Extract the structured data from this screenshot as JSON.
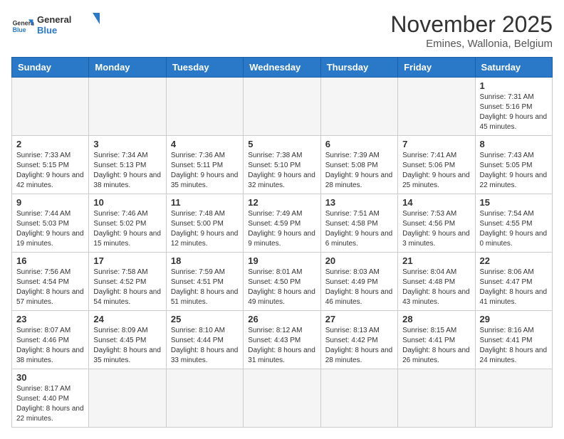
{
  "logo": {
    "line1": "General",
    "line2": "Blue"
  },
  "title": "November 2025",
  "location": "Emines, Wallonia, Belgium",
  "weekdays": [
    "Sunday",
    "Monday",
    "Tuesday",
    "Wednesday",
    "Thursday",
    "Friday",
    "Saturday"
  ],
  "weeks": [
    [
      {
        "day": "",
        "info": ""
      },
      {
        "day": "",
        "info": ""
      },
      {
        "day": "",
        "info": ""
      },
      {
        "day": "",
        "info": ""
      },
      {
        "day": "",
        "info": ""
      },
      {
        "day": "",
        "info": ""
      },
      {
        "day": "1",
        "info": "Sunrise: 7:31 AM\nSunset: 5:16 PM\nDaylight: 9 hours\nand 45 minutes."
      }
    ],
    [
      {
        "day": "2",
        "info": "Sunrise: 7:33 AM\nSunset: 5:15 PM\nDaylight: 9 hours\nand 42 minutes."
      },
      {
        "day": "3",
        "info": "Sunrise: 7:34 AM\nSunset: 5:13 PM\nDaylight: 9 hours\nand 38 minutes."
      },
      {
        "day": "4",
        "info": "Sunrise: 7:36 AM\nSunset: 5:11 PM\nDaylight: 9 hours\nand 35 minutes."
      },
      {
        "day": "5",
        "info": "Sunrise: 7:38 AM\nSunset: 5:10 PM\nDaylight: 9 hours\nand 32 minutes."
      },
      {
        "day": "6",
        "info": "Sunrise: 7:39 AM\nSunset: 5:08 PM\nDaylight: 9 hours\nand 28 minutes."
      },
      {
        "day": "7",
        "info": "Sunrise: 7:41 AM\nSunset: 5:06 PM\nDaylight: 9 hours\nand 25 minutes."
      },
      {
        "day": "8",
        "info": "Sunrise: 7:43 AM\nSunset: 5:05 PM\nDaylight: 9 hours\nand 22 minutes."
      }
    ],
    [
      {
        "day": "9",
        "info": "Sunrise: 7:44 AM\nSunset: 5:03 PM\nDaylight: 9 hours\nand 19 minutes."
      },
      {
        "day": "10",
        "info": "Sunrise: 7:46 AM\nSunset: 5:02 PM\nDaylight: 9 hours\nand 15 minutes."
      },
      {
        "day": "11",
        "info": "Sunrise: 7:48 AM\nSunset: 5:00 PM\nDaylight: 9 hours\nand 12 minutes."
      },
      {
        "day": "12",
        "info": "Sunrise: 7:49 AM\nSunset: 4:59 PM\nDaylight: 9 hours\nand 9 minutes."
      },
      {
        "day": "13",
        "info": "Sunrise: 7:51 AM\nSunset: 4:58 PM\nDaylight: 9 hours\nand 6 minutes."
      },
      {
        "day": "14",
        "info": "Sunrise: 7:53 AM\nSunset: 4:56 PM\nDaylight: 9 hours\nand 3 minutes."
      },
      {
        "day": "15",
        "info": "Sunrise: 7:54 AM\nSunset: 4:55 PM\nDaylight: 9 hours\nand 0 minutes."
      }
    ],
    [
      {
        "day": "16",
        "info": "Sunrise: 7:56 AM\nSunset: 4:54 PM\nDaylight: 8 hours\nand 57 minutes."
      },
      {
        "day": "17",
        "info": "Sunrise: 7:58 AM\nSunset: 4:52 PM\nDaylight: 8 hours\nand 54 minutes."
      },
      {
        "day": "18",
        "info": "Sunrise: 7:59 AM\nSunset: 4:51 PM\nDaylight: 8 hours\nand 51 minutes."
      },
      {
        "day": "19",
        "info": "Sunrise: 8:01 AM\nSunset: 4:50 PM\nDaylight: 8 hours\nand 49 minutes."
      },
      {
        "day": "20",
        "info": "Sunrise: 8:03 AM\nSunset: 4:49 PM\nDaylight: 8 hours\nand 46 minutes."
      },
      {
        "day": "21",
        "info": "Sunrise: 8:04 AM\nSunset: 4:48 PM\nDaylight: 8 hours\nand 43 minutes."
      },
      {
        "day": "22",
        "info": "Sunrise: 8:06 AM\nSunset: 4:47 PM\nDaylight: 8 hours\nand 41 minutes."
      }
    ],
    [
      {
        "day": "23",
        "info": "Sunrise: 8:07 AM\nSunset: 4:46 PM\nDaylight: 8 hours\nand 38 minutes."
      },
      {
        "day": "24",
        "info": "Sunrise: 8:09 AM\nSunset: 4:45 PM\nDaylight: 8 hours\nand 35 minutes."
      },
      {
        "day": "25",
        "info": "Sunrise: 8:10 AM\nSunset: 4:44 PM\nDaylight: 8 hours\nand 33 minutes."
      },
      {
        "day": "26",
        "info": "Sunrise: 8:12 AM\nSunset: 4:43 PM\nDaylight: 8 hours\nand 31 minutes."
      },
      {
        "day": "27",
        "info": "Sunrise: 8:13 AM\nSunset: 4:42 PM\nDaylight: 8 hours\nand 28 minutes."
      },
      {
        "day": "28",
        "info": "Sunrise: 8:15 AM\nSunset: 4:41 PM\nDaylight: 8 hours\nand 26 minutes."
      },
      {
        "day": "29",
        "info": "Sunrise: 8:16 AM\nSunset: 4:41 PM\nDaylight: 8 hours\nand 24 minutes."
      }
    ],
    [
      {
        "day": "30",
        "info": "Sunrise: 8:17 AM\nSunset: 4:40 PM\nDaylight: 8 hours\nand 22 minutes."
      },
      {
        "day": "",
        "info": ""
      },
      {
        "day": "",
        "info": ""
      },
      {
        "day": "",
        "info": ""
      },
      {
        "day": "",
        "info": ""
      },
      {
        "day": "",
        "info": ""
      },
      {
        "day": "",
        "info": ""
      }
    ]
  ]
}
